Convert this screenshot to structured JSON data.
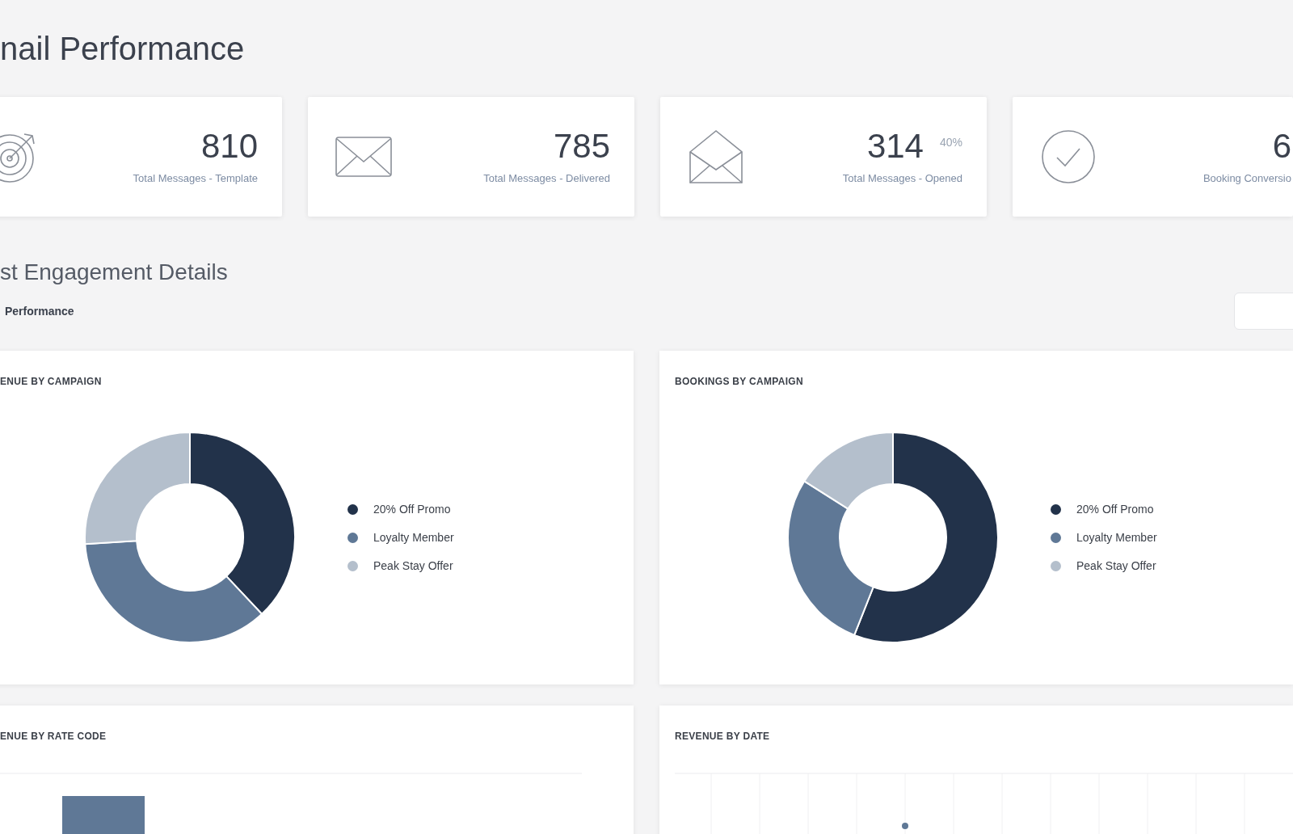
{
  "page_title": "nail Performance",
  "stat_cards": [
    {
      "number": "810",
      "label": "Total Messages - Template"
    },
    {
      "number": "785",
      "label": "Total Messages - Delivered"
    },
    {
      "number": "314",
      "percent": "40%",
      "label": "Total Messages - Opened"
    },
    {
      "number": "6",
      "label": "Booking Conversio"
    }
  ],
  "section": {
    "title": "st Engagement Details",
    "subtitle": "Performance"
  },
  "chart_cards": [
    {
      "kind": "donut",
      "title": "ENUE BY CAMPAIGN",
      "chart_data": {
        "type": "donut",
        "categories": [
          "20% Off Promo",
          "Loyalty Member",
          "Peak Stay Offer"
        ],
        "values": [
          38,
          36,
          26
        ],
        "colors": [
          "#22324a",
          "#5f7896",
          "#b4bfcc"
        ]
      }
    },
    {
      "kind": "donut",
      "title": "BOOKINGS BY CAMPAIGN",
      "chart_data": {
        "type": "donut",
        "categories": [
          "20% Off Promo",
          "Loyalty Member",
          "Peak Stay Offer"
        ],
        "values": [
          56,
          28,
          16
        ],
        "colors": [
          "#22324a",
          "#5f7896",
          "#b4bfcc"
        ]
      }
    },
    {
      "kind": "bar",
      "title": "ENUE BY RATE CODE"
    },
    {
      "kind": "line",
      "title": "REVENUE BY DATE"
    }
  ]
}
